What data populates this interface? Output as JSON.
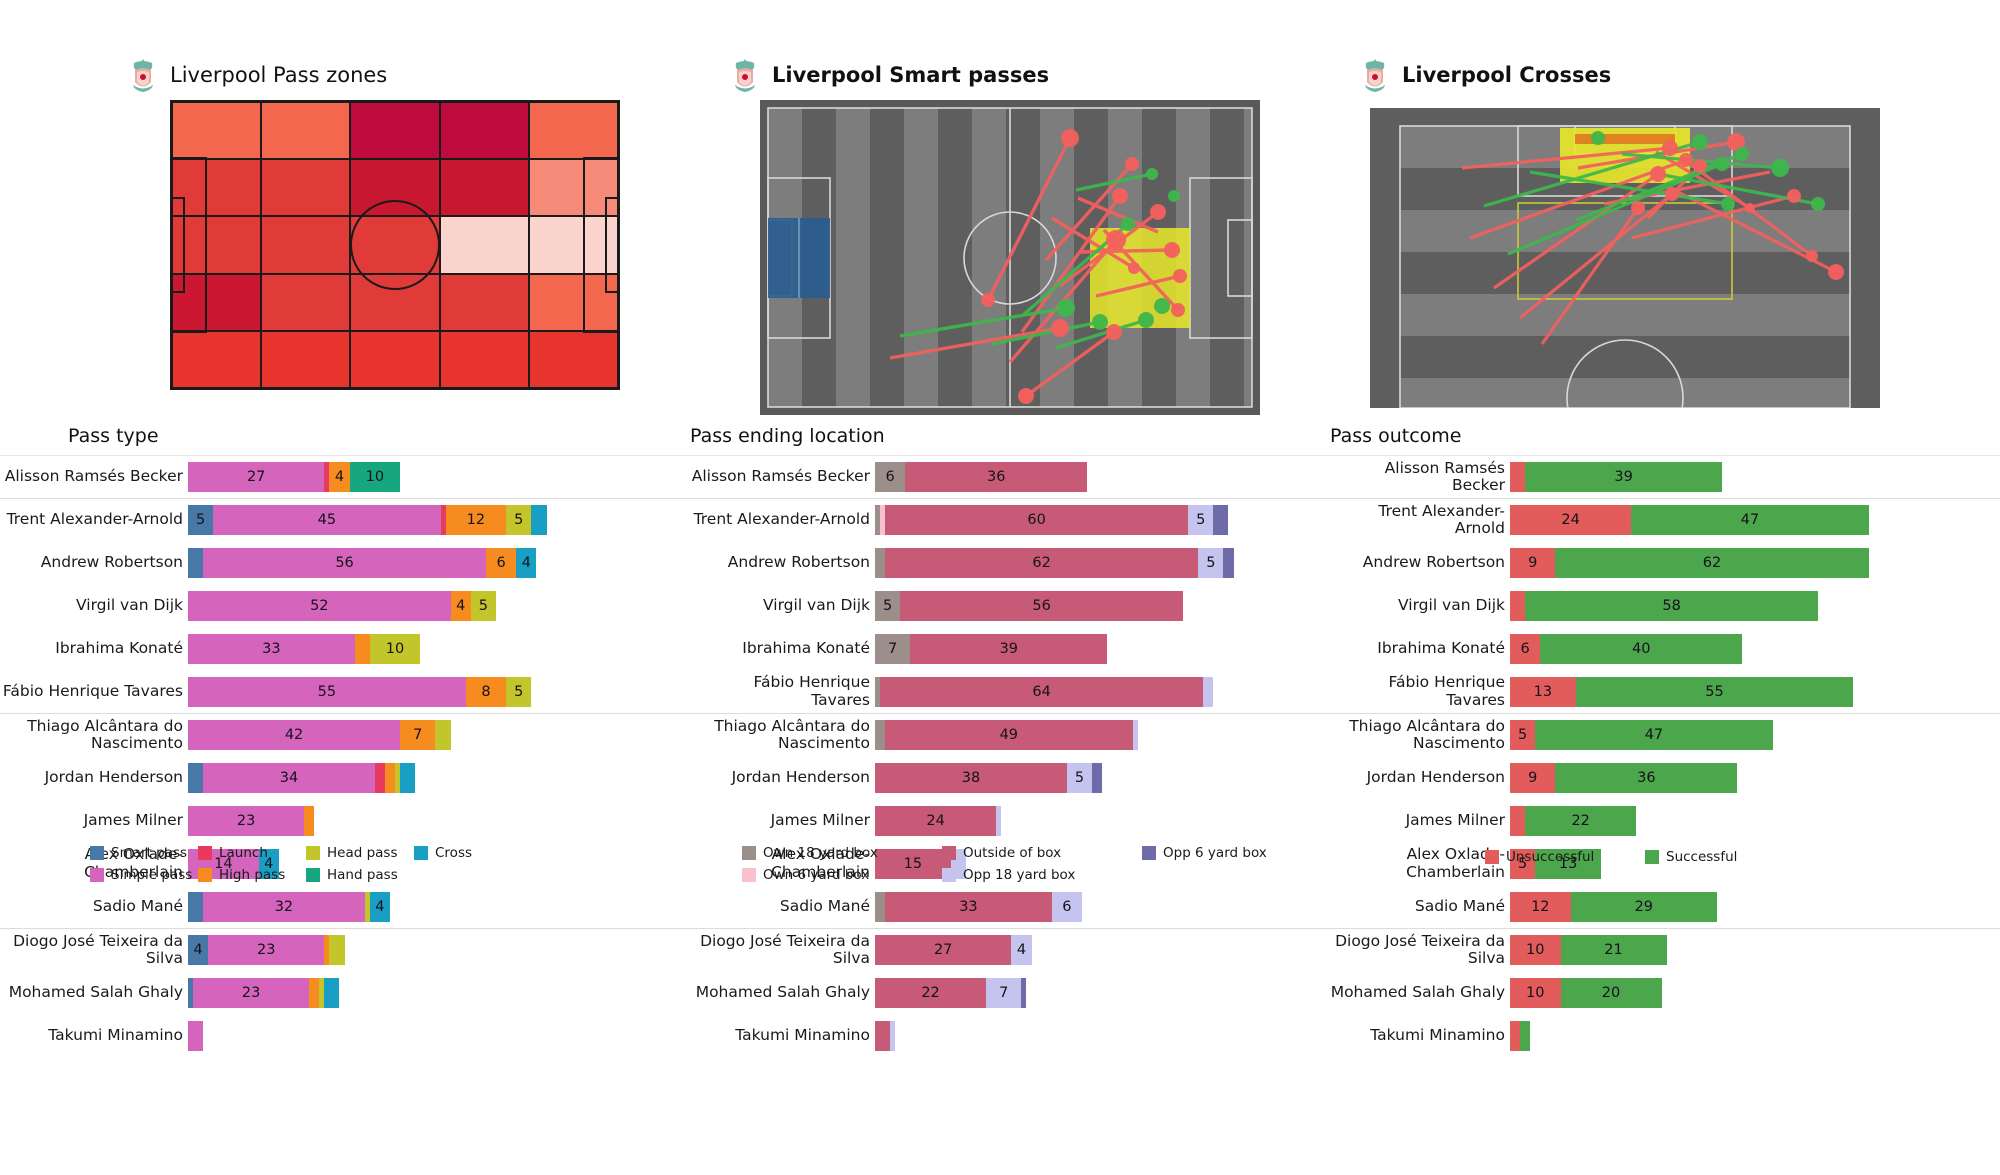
{
  "panels": [
    {
      "title": "Liverpool Pass zones",
      "title_bold": false,
      "crest_icon": "liverpool-crest-icon",
      "section_heading": "Pass type"
    },
    {
      "title": "Liverpool Smart passes",
      "title_bold": true,
      "crest_icon": "liverpool-crest-icon",
      "section_heading": "Pass ending location"
    },
    {
      "title": "Liverpool Crosses",
      "title_bold": true,
      "crest_icon": "liverpool-crest-icon",
      "section_heading": "Pass outcome"
    }
  ],
  "players": [
    "Alisson Ramsés Becker",
    "Trent Alexander-Arnold",
    "Andrew Robertson",
    "Virgil van Dijk",
    "Ibrahima Konaté",
    "Fábio Henrique Tavares",
    "Thiago Alcântara do Nascimento",
    "Jordan Henderson",
    "James Milner",
    "Alex Oxlade-Chamberlain",
    "Sadio Mané",
    "Diogo José Teixeira da Silva",
    "Mohamed  Salah Ghaly",
    "Takumi Minamino"
  ],
  "chart_data": [
    {
      "type": "bar",
      "orientation": "horizontal",
      "stacked": true,
      "title": "Pass type",
      "xlabel": "",
      "ylabel": "",
      "legend_position": "bottom",
      "grid": false,
      "xlim": [
        0,
        80
      ],
      "categories": [
        "Alisson Ramsés Becker",
        "Trent Alexander-Arnold",
        "Andrew Robertson",
        "Virgil van Dijk",
        "Ibrahima Konaté",
        "Fábio Henrique Tavares",
        "Thiago Alcântara do Nascimento",
        "Jordan Henderson",
        "James Milner",
        "Alex Oxlade-Chamberlain",
        "Sadio Mané",
        "Diogo José Teixeira da Silva",
        "Mohamed  Salah Ghaly",
        "Takumi Minamino"
      ],
      "series": [
        {
          "name": "Smart pass",
          "color": "#4878a8",
          "values": [
            0,
            5,
            3,
            0,
            0,
            0,
            0,
            3,
            0,
            0,
            3,
            4,
            1,
            0
          ]
        },
        {
          "name": "Simple pass",
          "color": "#d濃",
          "values": [
            27,
            45,
            56,
            52,
            33,
            55,
            42,
            34,
            23,
            14,
            32,
            23,
            23,
            3
          ]
        },
        {
          "name": "Launch",
          "color": "#e8395e",
          "values": [
            1,
            1,
            0,
            0,
            0,
            0,
            0,
            2,
            0,
            0,
            0,
            0,
            0,
            0
          ]
        },
        {
          "name": "High pass",
          "color": "#f68b1f",
          "values": [
            4,
            12,
            6,
            4,
            3,
            8,
            7,
            2,
            2,
            0,
            0,
            1,
            2,
            0
          ]
        },
        {
          "name": "Head pass",
          "color": "#c2c62b",
          "values": [
            0,
            5,
            0,
            5,
            10,
            5,
            3,
            1,
            0,
            0,
            1,
            3,
            1,
            0
          ]
        },
        {
          "name": "Hand pass",
          "color": "#17a77e",
          "values": [
            10,
            0,
            0,
            0,
            0,
            0,
            0,
            0,
            0,
            0,
            0,
            0,
            0,
            0
          ]
        },
        {
          "name": "Cross",
          "color": "#1a9fc4",
          "values": [
            0,
            3,
            4,
            0,
            0,
            0,
            0,
            3,
            0,
            4,
            4,
            0,
            3,
            0
          ]
        }
      ],
      "legend": [
        {
          "label": "Smart pass",
          "color": "#4878a8"
        },
        {
          "label": "Launch",
          "color": "#e8395e"
        },
        {
          "label": "Head pass",
          "color": "#c2c62b"
        },
        {
          "label": "Cross",
          "color": "#1a9fc4"
        },
        {
          "label": "Simple pass",
          "color": "#d濃"
        },
        {
          "label": "High pass",
          "color": "#f68b1f"
        },
        {
          "label": "Hand pass",
          "color": "#17a77e"
        }
      ]
    },
    {
      "type": "bar",
      "orientation": "horizontal",
      "stacked": true,
      "title": "Pass ending location",
      "xlabel": "",
      "ylabel": "",
      "legend_position": "bottom",
      "grid": false,
      "xlim": [
        0,
        80
      ],
      "categories": [
        "Alisson Ramsés Becker",
        "Trent Alexander-Arnold",
        "Andrew Robertson",
        "Virgil van Dijk",
        "Ibrahima Konaté",
        "Fábio Henrique Tavares",
        "Thiago Alcântara do Nascimento",
        "Jordan Henderson",
        "James Milner",
        "Alex Oxlade-Chamberlain",
        "Sadio Mané",
        "Diogo José Teixeira da Silva",
        "Mohamed  Salah Ghaly",
        "Takumi Minamino"
      ],
      "series": [
        {
          "name": "Own 18 yard box",
          "color": "#9c8f8a",
          "values": [
            6,
            1,
            2,
            5,
            7,
            1,
            2,
            0,
            0,
            0,
            2,
            0,
            0,
            0
          ]
        },
        {
          "name": "Own 6 yard box",
          "color": "#f9c0ce",
          "values": [
            0,
            1,
            0,
            0,
            0,
            0,
            0,
            0,
            0,
            0,
            0,
            0,
            0,
            0
          ]
        },
        {
          "name": "Outside of box",
          "color": "#c75a77",
          "values": [
            36,
            60,
            62,
            56,
            39,
            64,
            49,
            38,
            24,
            15,
            33,
            27,
            22,
            3
          ]
        },
        {
          "name": "Opp 18 yard box",
          "color": "#c5c4ee",
          "values": [
            0,
            5,
            5,
            0,
            0,
            2,
            1,
            5,
            1,
            3,
            6,
            4,
            7,
            1
          ]
        },
        {
          "name": "Opp 6 yard box",
          "color": "#6f6aa8",
          "values": [
            0,
            3,
            2,
            0,
            0,
            0,
            0,
            2,
            0,
            0,
            0,
            0,
            1,
            0
          ]
        }
      ],
      "legend": [
        {
          "label": "Own 18 yard box",
          "color": "#9c8f8a"
        },
        {
          "label": "Outside of box",
          "color": "#c75a77"
        },
        {
          "label": "Opp 6 yard box",
          "color": "#6f6aa8"
        },
        {
          "label": "Own 6 yard box",
          "color": "#f9c0ce"
        },
        {
          "label": "Opp 18 yard box",
          "color": "#c5c4ee"
        }
      ]
    },
    {
      "type": "bar",
      "orientation": "horizontal",
      "stacked": true,
      "title": "Pass outcome",
      "xlabel": "",
      "ylabel": "",
      "legend_position": "bottom",
      "grid": false,
      "xlim": [
        0,
        80
      ],
      "categories": [
        "Alisson Ramsés Becker",
        "Trent Alexander-Arnold",
        "Andrew Robertson",
        "Virgil van Dijk",
        "Ibrahima Konaté",
        "Fábio Henrique Tavares",
        "Thiago Alcântara do Nascimento",
        "Jordan Henderson",
        "James Milner",
        "Alex Oxlade-Chamberlain",
        "Sadio Mané",
        "Diogo José Teixeira da Silva",
        "Mohamed  Salah Ghaly",
        "Takumi Minamino"
      ],
      "series": [
        {
          "name": "Unsuccessful",
          "color": "#e25c5c",
          "values": [
            3,
            24,
            9,
            3,
            6,
            13,
            5,
            9,
            3,
            5,
            12,
            10,
            10,
            2
          ]
        },
        {
          "name": "Successful",
          "color": "#4ca64c",
          "values": [
            39,
            47,
            62,
            58,
            40,
            55,
            47,
            36,
            22,
            13,
            29,
            21,
            20,
            2
          ]
        }
      ],
      "legend": [
        {
          "label": "Unsuccessful",
          "color": "#e25c5c"
        },
        {
          "label": "Successful",
          "color": "#4ca64c"
        }
      ]
    }
  ],
  "pass_zones": {
    "type": "heatmap",
    "rows": 5,
    "cols": 5,
    "colors": [
      [
        "#f4674f",
        "#f4674f",
        "#bf0c3f",
        "#bf0c3f",
        "#f4674f"
      ],
      [
        "#e03b38",
        "#e03b38",
        "#c8182f",
        "#c8182f",
        "#f58a78"
      ],
      [
        "#e03b38",
        "#e03b38",
        "#e03b38",
        "#fbd5cd",
        "#fbd5cd"
      ],
      [
        "#cc1733",
        "#e03b38",
        "#e03b38",
        "#e03b38",
        "#f4674f"
      ],
      [
        "#e8342f",
        "#e8342f",
        "#e8342f",
        "#e8342f",
        "#e8342f"
      ]
    ]
  }
}
